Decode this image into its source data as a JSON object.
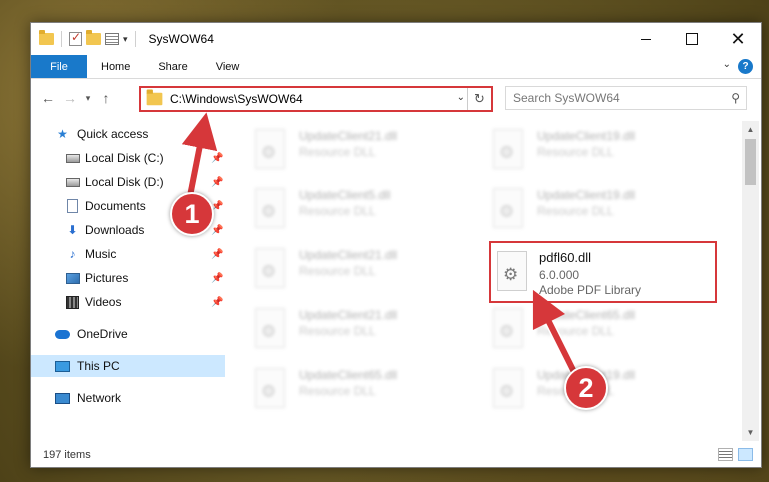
{
  "window": {
    "title": "SysWOW64"
  },
  "ribbon": {
    "tabs": [
      "File",
      "Home",
      "Share",
      "View"
    ],
    "help": "?"
  },
  "address": {
    "path": "C:\\Windows\\SysWOW64",
    "search_placeholder": "Search SysWOW64"
  },
  "sidebar": {
    "quick_access": "Quick access",
    "items": [
      {
        "label": "Local Disk (C:)",
        "pinned": true
      },
      {
        "label": "Local Disk (D:)",
        "pinned": true
      },
      {
        "label": "Documents",
        "pinned": true
      },
      {
        "label": "Downloads",
        "pinned": true
      },
      {
        "label": "Music",
        "pinned": true
      },
      {
        "label": "Pictures",
        "pinned": true
      },
      {
        "label": "Videos",
        "pinned": true
      }
    ],
    "onedrive": "OneDrive",
    "this_pc": "This PC",
    "network": "Network"
  },
  "files": {
    "left_column": [
      {
        "name": "UpdateClient21.dll",
        "desc": "Resource DLL"
      },
      {
        "name": "UpdateClient5.dll",
        "desc": "Resource DLL"
      },
      {
        "name": "UpdateClient21.dll",
        "desc": "Resource DLL"
      },
      {
        "name": "UpdateClient21.dll",
        "desc": "Resource DLL"
      },
      {
        "name": "UpdateClient65.dll",
        "desc": "Resource DLL"
      }
    ],
    "right_column": [
      {
        "name": "UpdateClient19.dll",
        "desc": "Resource DLL"
      },
      {
        "name": "UpdateClient19.dll",
        "desc": "Resource DLL"
      },
      {
        "name": "UpdateClient65.dll",
        "desc": "Resource DLL"
      },
      {
        "name": "UpdateClient19.dll",
        "desc": "Resource DLL"
      }
    ],
    "highlighted": {
      "name": "pdfl60.dll",
      "version": "6.0.000",
      "desc": "Adobe PDF Library"
    }
  },
  "status": {
    "item_count": "197 items"
  },
  "annotations": {
    "step1": "1",
    "step2": "2",
    "color": "#d6373a"
  }
}
